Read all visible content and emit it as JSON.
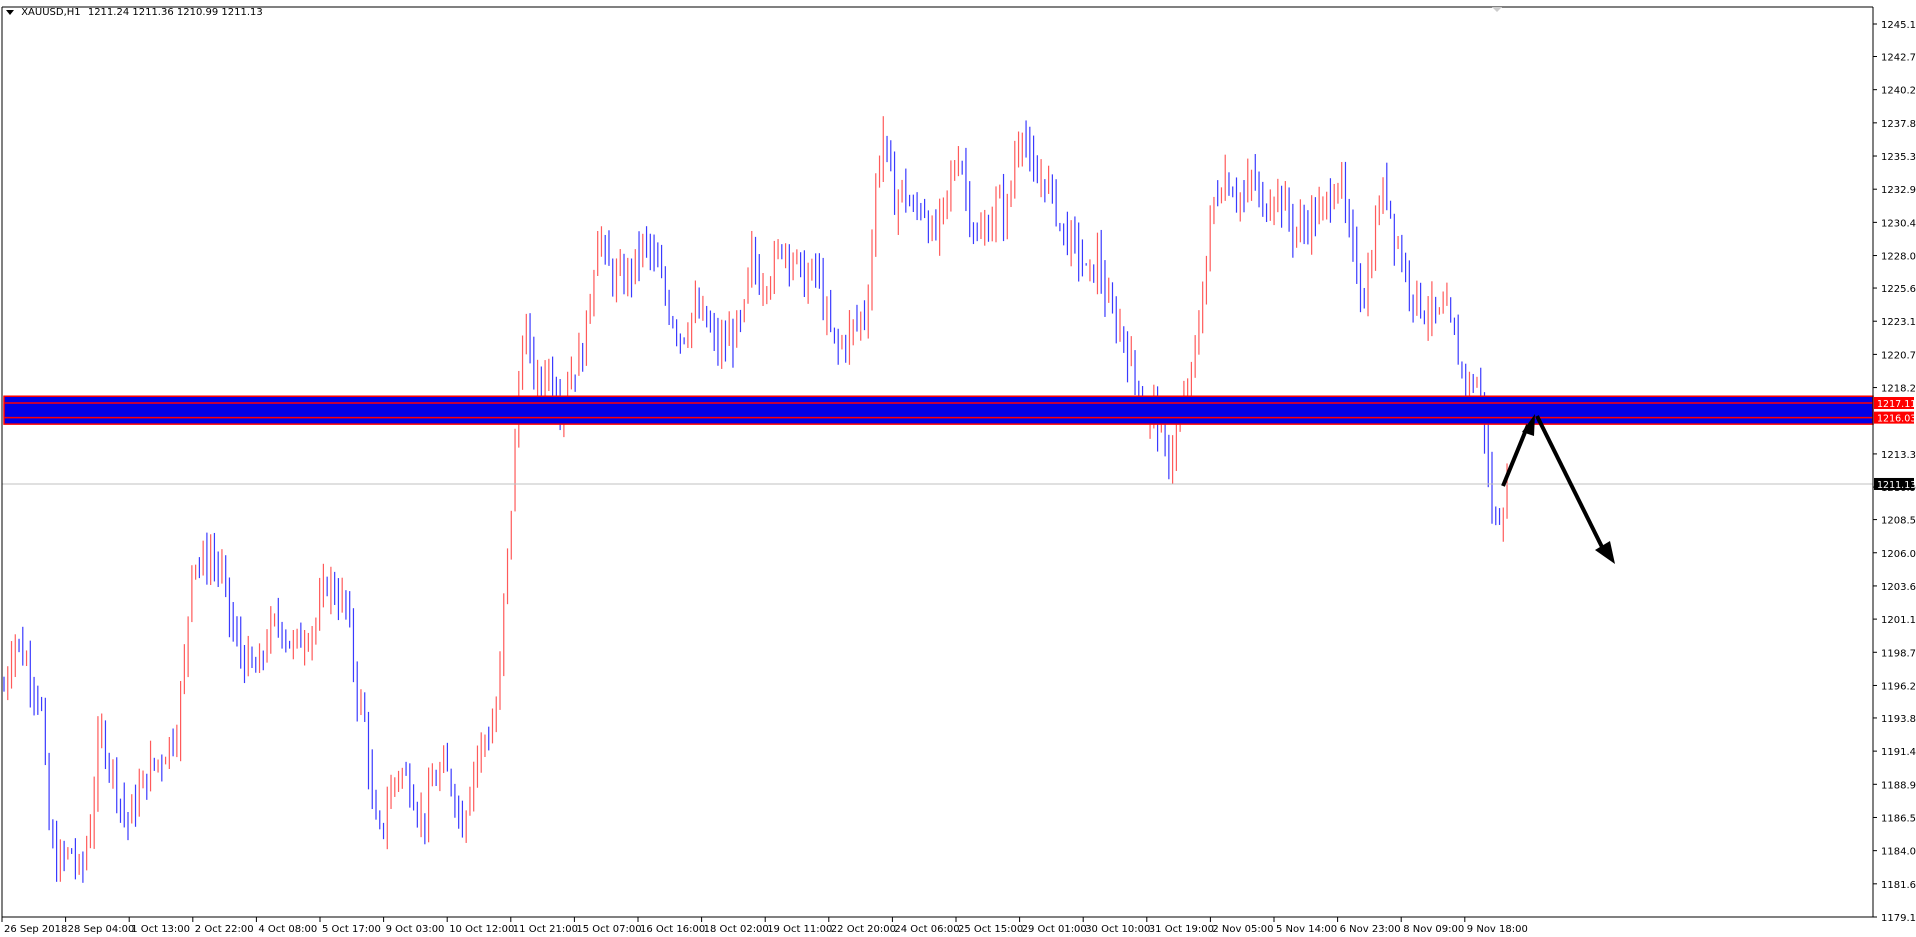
{
  "window": {
    "symbol_title": "XAUUSD,H1",
    "ohlc_text": "1211.24 1211.36 1210.99 1211.13"
  },
  "colors": {
    "bull": "#ff5a5a",
    "bear": "#3a3aff",
    "zone_fill": "#0000e6",
    "zone_border": "#ff0000",
    "axis": "#000000",
    "bid_line": "#c0c0c0",
    "arrow": "#000000"
  },
  "price_axis": {
    "ticks": [
      "1245.10",
      "1242.70",
      "1240.25",
      "1237.80",
      "1235.35",
      "1232.90",
      "1230.45",
      "1228.00",
      "1225.60",
      "1223.15",
      "1220.70",
      "1218.25",
      "1213.35",
      "1210.90",
      "1208.50",
      "1206.05",
      "1203.60",
      "1201.15",
      "1198.70",
      "1196.25",
      "1193.85",
      "1191.40",
      "1188.95",
      "1186.50",
      "1184.05",
      "1181.60",
      "1179.15"
    ],
    "labels": [
      {
        "text": "1217.11",
        "price": 1217.11,
        "bg": "#ff0000",
        "fg": "#ffffff"
      },
      {
        "text": "1216.03",
        "price": 1216.03,
        "bg": "#ff0000",
        "fg": "#ffffff"
      },
      {
        "text": "1211.13",
        "price": 1211.13,
        "bg": "#000000",
        "fg": "#ffffff"
      }
    ]
  },
  "time_axis": {
    "ticks": [
      "26 Sep 2018",
      "28 Sep 04:00",
      "1 Oct 13:00",
      "2 Oct 22:00",
      "4 Oct 08:00",
      "5 Oct 17:00",
      "9 Oct 03:00",
      "10 Oct 12:00",
      "11 Oct 21:00",
      "15 Oct 07:00",
      "16 Oct 16:00",
      "18 Oct 02:00",
      "19 Oct 11:00",
      "22 Oct 20:00",
      "24 Oct 06:00",
      "25 Oct 15:00",
      "29 Oct 01:00",
      "30 Oct 10:00",
      "31 Oct 19:00",
      "2 Nov 05:00",
      "5 Nov 14:00",
      "6 Nov 23:00",
      "8 Nov 09:00",
      "9 Nov 18:00"
    ]
  },
  "zone": {
    "top_price": 1217.61,
    "bottom_price": 1215.55
  },
  "bid_price": 1211.13,
  "chart_data": {
    "type": "line",
    "title": "XAUUSD,H1",
    "series": [
      {
        "name": "XAUUSD,H1",
        "x_labels": [
          "26 Sep",
          "28 Sep",
          "1 Oct",
          "2 Oct",
          "4 Oct",
          "5 Oct",
          "9 Oct",
          "10 Oct",
          "11 Oct",
          "15 Oct",
          "16 Oct",
          "18 Oct",
          "19 Oct",
          "22 Oct",
          "24 Oct",
          "25 Oct",
          "29 Oct",
          "30 Oct",
          "31 Oct",
          "2 Nov",
          "5 Nov",
          "6 Nov",
          "8 Nov",
          "9 Nov"
        ],
        "values": [
          1197,
          1184,
          1190,
          1206,
          1198,
          1202,
          1188,
          1198,
          1222,
          1230,
          1223,
          1227,
          1228,
          1231,
          1233,
          1237,
          1229,
          1218,
          1214,
          1234,
          1233,
          1232,
          1222,
          1211
        ]
      }
    ],
    "ylim": [
      1179.15,
      1245.1
    ],
    "path_keypoints": [
      [
        0,
        1196
      ],
      [
        8,
        1200
      ],
      [
        18,
        1198
      ],
      [
        30,
        1195
      ],
      [
        36,
        1186
      ],
      [
        42,
        1183
      ],
      [
        55,
        1184
      ],
      [
        62,
        1182
      ],
      [
        70,
        1186
      ],
      [
        78,
        1193
      ],
      [
        88,
        1190
      ],
      [
        100,
        1186
      ],
      [
        108,
        1188
      ],
      [
        118,
        1190
      ],
      [
        128,
        1191
      ],
      [
        140,
        1193
      ],
      [
        148,
        1199
      ],
      [
        152,
        1206
      ],
      [
        160,
        1205
      ],
      [
        168,
        1206
      ],
      [
        178,
        1204
      ],
      [
        186,
        1200
      ],
      [
        196,
        1198
      ],
      [
        206,
        1197
      ],
      [
        214,
        1200
      ],
      [
        224,
        1201
      ],
      [
        234,
        1199
      ],
      [
        244,
        1200
      ],
      [
        254,
        1201
      ],
      [
        262,
        1204
      ],
      [
        270,
        1203
      ],
      [
        278,
        1202
      ],
      [
        286,
        1196
      ],
      [
        294,
        1193
      ],
      [
        300,
        1186
      ],
      [
        306,
        1185
      ],
      [
        312,
        1188
      ],
      [
        320,
        1190
      ],
      [
        330,
        1189
      ],
      [
        340,
        1186
      ],
      [
        348,
        1189
      ],
      [
        356,
        1190
      ],
      [
        364,
        1189
      ],
      [
        372,
        1186
      ],
      [
        380,
        1190
      ],
      [
        388,
        1192
      ],
      [
        396,
        1193
      ],
      [
        402,
        1196
      ],
      [
        406,
        1203
      ],
      [
        410,
        1207
      ],
      [
        414,
        1213
      ],
      [
        418,
        1219
      ],
      [
        422,
        1223
      ],
      [
        428,
        1220
      ],
      [
        434,
        1218
      ],
      [
        440,
        1220
      ],
      [
        446,
        1219
      ],
      [
        452,
        1217
      ],
      [
        458,
        1219
      ],
      [
        464,
        1220
      ],
      [
        470,
        1221
      ],
      [
        476,
        1225
      ],
      [
        482,
        1230
      ],
      [
        490,
        1227
      ],
      [
        500,
        1226
      ],
      [
        510,
        1227
      ],
      [
        520,
        1229
      ],
      [
        530,
        1227
      ],
      [
        540,
        1224
      ],
      [
        550,
        1222
      ],
      [
        560,
        1224
      ],
      [
        570,
        1223
      ],
      [
        580,
        1221
      ],
      [
        590,
        1222
      ],
      [
        600,
        1223
      ],
      [
        606,
        1228
      ],
      [
        614,
        1226
      ],
      [
        624,
        1227
      ],
      [
        632,
        1229
      ],
      [
        640,
        1228
      ],
      [
        650,
        1226
      ],
      [
        660,
        1227
      ],
      [
        668,
        1223
      ],
      [
        676,
        1221
      ],
      [
        684,
        1222
      ],
      [
        692,
        1223
      ],
      [
        700,
        1224
      ],
      [
        704,
        1228
      ],
      [
        708,
        1234
      ],
      [
        714,
        1237
      ],
      [
        722,
        1232
      ],
      [
        730,
        1233
      ],
      [
        738,
        1231
      ],
      [
        746,
        1232
      ],
      [
        754,
        1229
      ],
      [
        762,
        1231
      ],
      [
        770,
        1234
      ],
      [
        776,
        1236
      ],
      [
        782,
        1232
      ],
      [
        790,
        1229
      ],
      [
        798,
        1230
      ],
      [
        806,
        1232
      ],
      [
        814,
        1231
      ],
      [
        820,
        1235
      ],
      [
        826,
        1238
      ],
      [
        830,
        1236
      ],
      [
        836,
        1233
      ],
      [
        844,
        1234
      ],
      [
        852,
        1232
      ],
      [
        858,
        1230
      ],
      [
        866,
        1229
      ],
      [
        874,
        1228
      ],
      [
        880,
        1226
      ],
      [
        888,
        1228
      ],
      [
        896,
        1224
      ],
      [
        904,
        1223
      ],
      [
        912,
        1221
      ],
      [
        920,
        1218
      ],
      [
        928,
        1216
      ],
      [
        934,
        1217
      ],
      [
        940,
        1214
      ],
      [
        946,
        1213
      ],
      [
        952,
        1215
      ],
      [
        958,
        1217
      ],
      [
        964,
        1219
      ],
      [
        970,
        1223
      ],
      [
        976,
        1228
      ],
      [
        982,
        1232
      ],
      [
        990,
        1234
      ],
      [
        998,
        1233
      ],
      [
        1006,
        1232
      ],
      [
        1014,
        1234
      ],
      [
        1022,
        1231
      ],
      [
        1030,
        1233
      ],
      [
        1038,
        1232
      ],
      [
        1046,
        1230
      ],
      [
        1054,
        1230
      ],
      [
        1062,
        1231
      ],
      [
        1070,
        1231
      ],
      [
        1078,
        1233
      ],
      [
        1084,
        1234
      ],
      [
        1090,
        1230
      ],
      [
        1098,
        1227
      ],
      [
        1104,
        1225
      ],
      [
        1110,
        1228
      ],
      [
        1116,
        1232
      ],
      [
        1122,
        1233
      ],
      [
        1128,
        1230
      ],
      [
        1134,
        1228
      ],
      [
        1140,
        1226
      ],
      [
        1146,
        1225
      ],
      [
        1152,
        1224
      ],
      [
        1158,
        1224
      ],
      [
        1164,
        1223
      ],
      [
        1170,
        1224
      ],
      [
        1176,
        1222
      ],
      [
        1182,
        1220
      ],
      [
        1188,
        1218
      ],
      [
        1194,
        1219
      ],
      [
        1198,
        1218
      ],
      [
        1202,
        1215
      ],
      [
        1206,
        1210
      ],
      [
        1210,
        1208
      ],
      [
        1214,
        1209
      ],
      [
        1218,
        1210
      ],
      [
        1222,
        1211.13
      ]
    ]
  }
}
